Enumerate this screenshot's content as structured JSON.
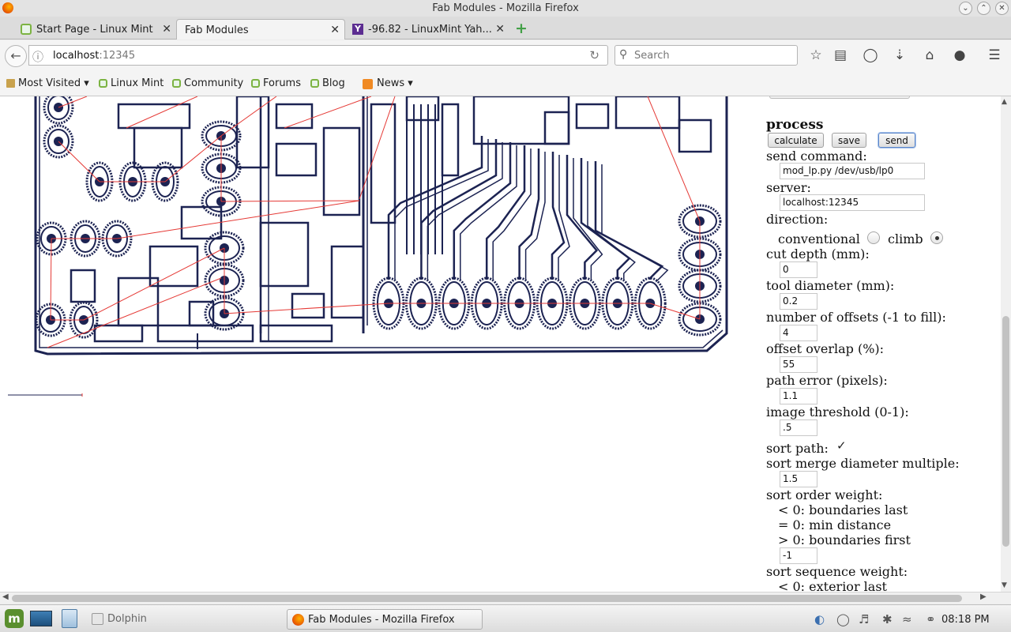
{
  "window": {
    "title": "Fab Modules - Mozilla Firefox"
  },
  "tabs": [
    {
      "label": "Start Page - Linux Mint",
      "active": false,
      "icon": "linux-mint-icon"
    },
    {
      "label": "Fab Modules",
      "active": true,
      "icon": "none"
    },
    {
      "label": "-96.82 - LinuxMint Yah...",
      "active": false,
      "icon": "yahoo-icon"
    }
  ],
  "nav": {
    "url_host": "localhost",
    "url_port": ":12345",
    "search_placeholder": "Search"
  },
  "bookmarks": [
    {
      "label": "Most Visited",
      "type": "folder"
    },
    {
      "label": "Linux Mint",
      "type": "link"
    },
    {
      "label": "Community",
      "type": "link"
    },
    {
      "label": "Forums",
      "type": "link"
    },
    {
      "label": "Blog",
      "type": "link"
    },
    {
      "label": "News",
      "type": "rss"
    }
  ],
  "panel": {
    "heading": "process",
    "buttons": {
      "calculate": "calculate",
      "save": "save",
      "send": "send"
    },
    "send_command_label": "send command:",
    "send_command_value": "mod_lp.py /dev/usb/lp0",
    "server_label": "server:",
    "server_value": "localhost:12345",
    "direction_label": "direction:",
    "direction_conventional": "conventional",
    "direction_climb": "climb",
    "direction_selected": "climb",
    "cut_depth_label": "cut depth (mm):",
    "cut_depth_value": "0",
    "tool_diameter_label": "tool diameter (mm):",
    "tool_diameter_value": "0.2",
    "offsets_label": "number of offsets (-1 to fill):",
    "offsets_value": "4",
    "overlap_label": "offset overlap (%):",
    "overlap_value": "55",
    "path_error_label": "path error (pixels):",
    "path_error_value": "1.1",
    "threshold_label": "image threshold (0-1):",
    "threshold_value": ".5",
    "sort_path_label": "sort path:",
    "sort_path_checked": true,
    "merge_label": "sort merge diameter multiple:",
    "merge_value": "1.5",
    "order_label": "sort order weight:",
    "order_lt": "< 0: boundaries last",
    "order_eq": "= 0: min distance",
    "order_gt": "> 0: boundaries first",
    "order_value": "-1",
    "sequence_label": "sort sequence weight:",
    "sequence_lt": "< 0: exterior last"
  },
  "taskbar": {
    "dolphin_label": "Dolphin",
    "firefox_label": "Fab Modules - Mozilla Firefox",
    "clock": "08:18 PM"
  },
  "colors": {
    "toolpath": "#1c2352",
    "travel": "#e53935",
    "accent": "#5b86c9"
  }
}
